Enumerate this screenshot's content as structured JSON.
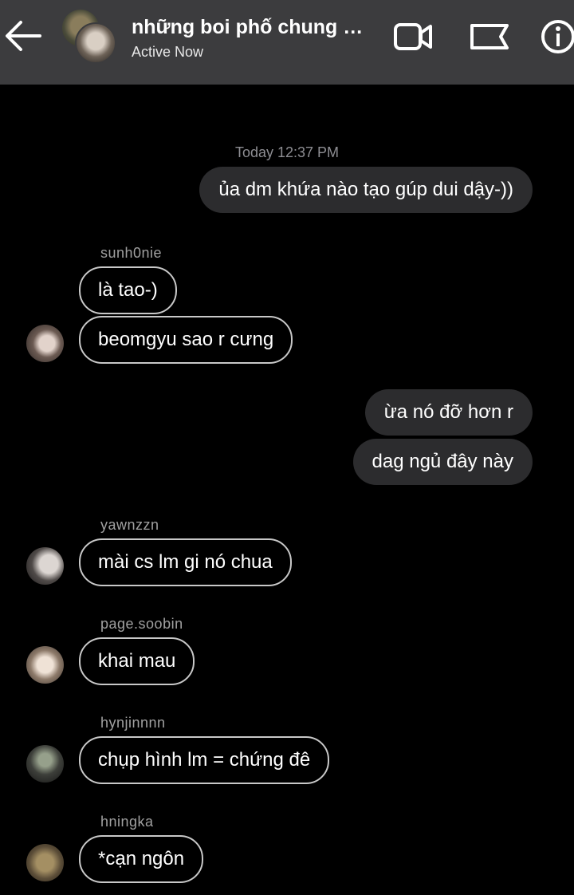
{
  "header": {
    "title": "những boi phố chung cư ...",
    "status": "Active Now"
  },
  "conversation": {
    "timestamp": "Today 12:37 PM",
    "outgoing_1": "ủa dm khứa nào tạo gúp dui dậy-))",
    "group_1": {
      "sender": "sunh0nie",
      "messages": [
        "là tao-)",
        "beomgyu sao r cưng"
      ]
    },
    "outgoing_2": [
      "ừa nó đỡ hơn r",
      "dag ngủ đây này"
    ],
    "group_2": {
      "sender": "yawnzzn",
      "message": "mài cs lm gi nó chua"
    },
    "group_3": {
      "sender": "page.soobin",
      "message": "khai mau"
    },
    "group_4": {
      "sender": "hynjinnnn",
      "message": "chụp hình lm = chứng đê"
    },
    "group_5": {
      "sender": "hningka",
      "message": "*cạn ngôn"
    }
  },
  "icons": {
    "back": "arrow-left-icon",
    "video": "video-camera-icon",
    "flag": "flag-icon",
    "info": "info-icon"
  },
  "colors": {
    "background": "#000000",
    "header": "#3c3c3e",
    "outgoing_bubble": "#2c2c2e",
    "incoming_border": "#c8c8c8",
    "meta_text": "#8e8e93"
  }
}
